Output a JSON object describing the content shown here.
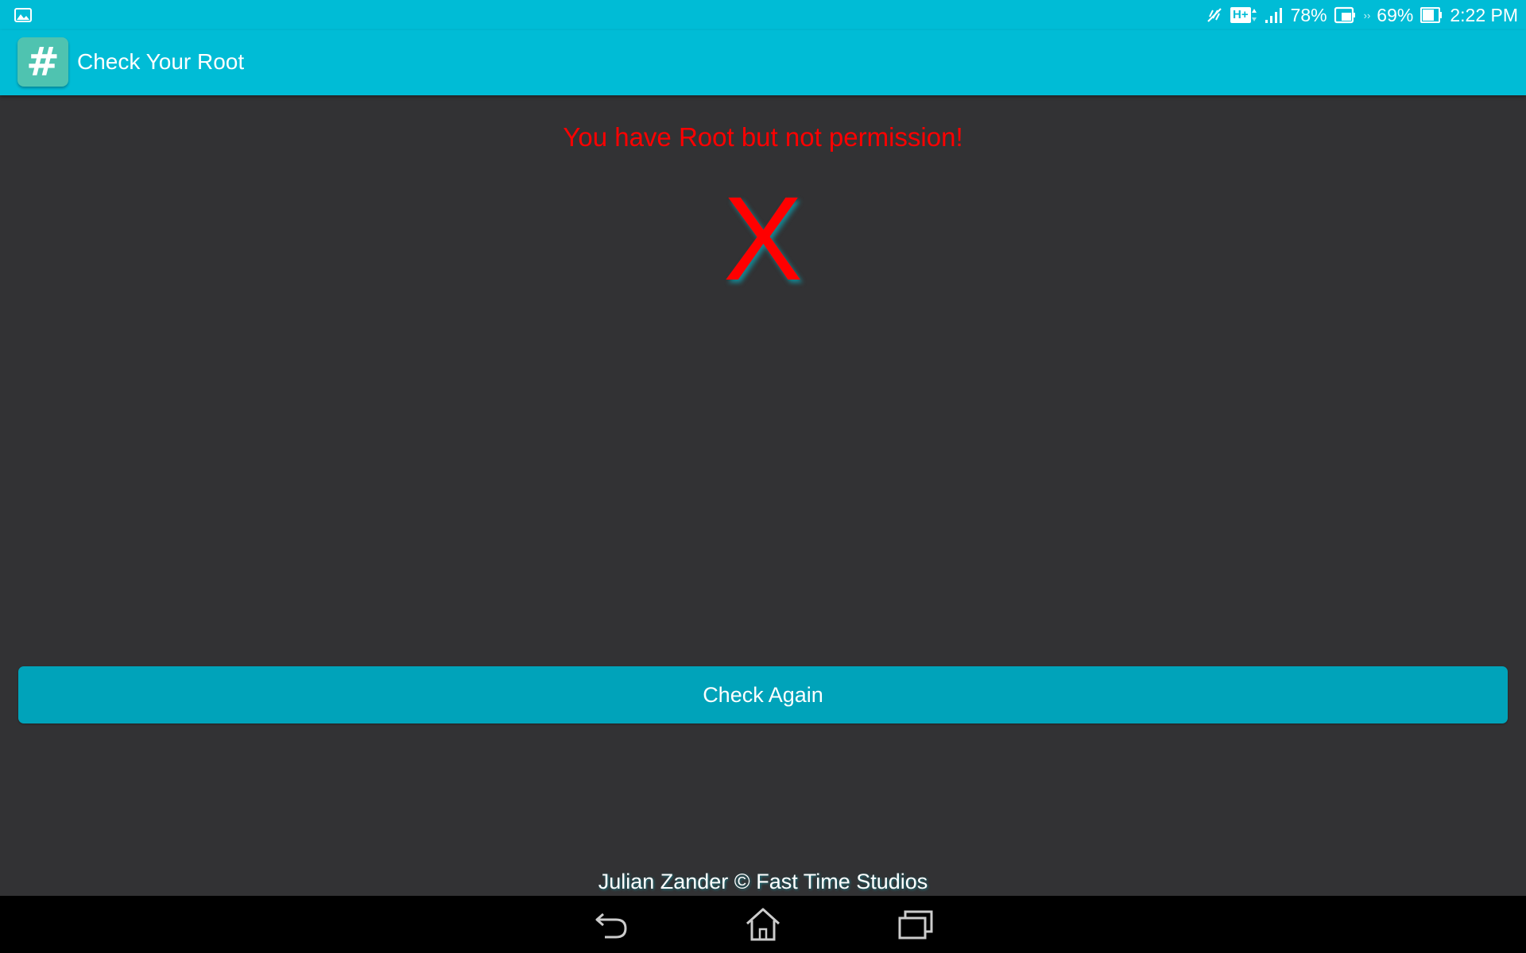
{
  "status_bar": {
    "notification_icon": "gallery-icon",
    "mute_icon": "vibrate-off-icon",
    "network_type": "H+",
    "signal_icon": "signal-icon",
    "battery_primary": "78%",
    "dock_icon": "tablet-battery-icon",
    "battery_secondary": "69%",
    "battery_icon": "battery-icon",
    "time": "2:22 PM"
  },
  "app_bar": {
    "icon_glyph": "#",
    "title": "Check Your Root"
  },
  "content": {
    "message": "You have Root but not permission!",
    "result_symbol": "X",
    "check_button_label": "Check Again",
    "credit": "Julian Zander © Fast Time Studios"
  },
  "nav_bar": {
    "back": "back-icon",
    "home": "home-icon",
    "recents": "recents-icon"
  },
  "colors": {
    "accent": "#00bcd6",
    "button": "#00a3ba",
    "background": "#323234",
    "error": "#ff0000"
  }
}
